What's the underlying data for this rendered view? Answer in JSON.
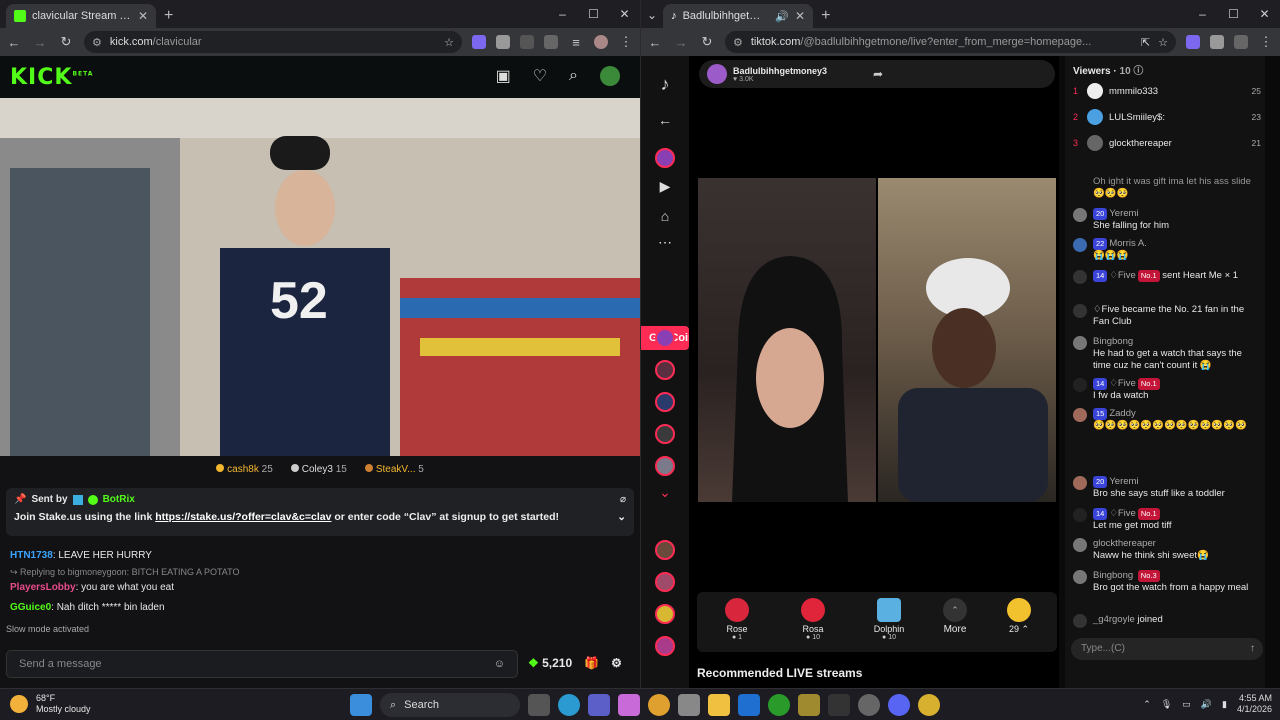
{
  "left_browser": {
    "tab_title": "clavicular Stream - Watch Live o",
    "url_domain": "kick.com",
    "url_path": "/clavicular",
    "logo_text": "KICK",
    "logo_sup": "BETA",
    "top_viewers": [
      {
        "name": "cash8k",
        "count": "25"
      },
      {
        "name": "Coley3",
        "count": "15"
      },
      {
        "name": "SteakV...",
        "count": "5"
      }
    ],
    "pinned": {
      "sent_by_label": "Sent by",
      "sender": "BotRix",
      "message_pre": "Join Stake.us using the link ",
      "link": "https://stake.us/?offer=clav&c=clav",
      "message_post": " or enter code “Clav” at signup to get started!"
    },
    "chat": [
      {
        "user": "HTN1738",
        "text": ": LEAVE HER HURRY"
      },
      {
        "reply": "Replying to bigmoneygoon: BITCH EATING A POTATO"
      },
      {
        "user": "PlayersLobby",
        "text": ": you are what you eat"
      },
      {
        "user": "GGuice0",
        "text": ": Nah ditch ***** bin laden"
      }
    ],
    "slow_mode": "Slow mode activated",
    "send_placeholder": "Send a message",
    "points": "5,210"
  },
  "right_browser": {
    "tab_title": "Badlulbihhgetmoney3 (@b...",
    "url_domain": "tiktok.com",
    "url_path": "/@badlulbihhgetmone/live?enter_from_merge=homepage...",
    "streamer_name": "Badlulbihhgetmoney3",
    "streamer_likes": "3.0K",
    "get_coins": "Get Coins",
    "gifts": [
      {
        "name": "Rose",
        "cost": "1"
      },
      {
        "name": "Rosa",
        "cost": "10"
      },
      {
        "name": "Dolphin",
        "cost": "10"
      }
    ],
    "more_label": "More",
    "coin_count": "29",
    "recommended": "Recommended LIVE streams",
    "viewers_label": "Viewers",
    "viewers_count": "10",
    "top_viewers": [
      {
        "rank": "1",
        "name": "mmmilo333",
        "score": "25"
      },
      {
        "rank": "2",
        "name": "LULSmiiley$:",
        "score": "23"
      },
      {
        "rank": "3",
        "name": "glockthereaper",
        "score": "21"
      }
    ],
    "messages": [
      {
        "name": "",
        "badge": "",
        "text": "Oh ight it was gift ima let his ass slide🥺🥺🥺"
      },
      {
        "name": "Yeremi",
        "badge": "20",
        "text": "She falling for him"
      },
      {
        "name": "Morris A.",
        "badge": "22",
        "text": "😭😭😭"
      },
      {
        "name": "♢Five",
        "badge": "14",
        "text": "sent Heart Me × 1"
      },
      {
        "name": "",
        "badge": "",
        "text": "♢Five became the No. 21 fan in the Fan Club"
      },
      {
        "name": "Bingbong",
        "badge": "",
        "text": "He had to get a watch that says the time cuz he can't count it 😭"
      },
      {
        "name": "♢Five",
        "badge": "14",
        "text": "I fw da watch"
      },
      {
        "name": "Zaddy",
        "badge": "15",
        "text": "🥺🥺🥺🥺🥺🥺🥺🥺🥺🥺🥺🥺🥺"
      },
      {
        "name": "Yeremi",
        "badge": "20",
        "text": "Bro she says stuff like a toddler"
      },
      {
        "name": "♢Five",
        "badge": "14",
        "text": "Let me get mod tiff"
      },
      {
        "name": "glockthereaper",
        "badge": "",
        "text": "Naww he think shi sweet😭"
      },
      {
        "name": "Bingbong",
        "badge": "",
        "text": "Bro got the watch from a happy meal"
      },
      {
        "name": "_g4rgoyle",
        "badge": "",
        "text": "joined"
      }
    ],
    "input_placeholder": "Type...(C)"
  },
  "taskbar": {
    "temp": "68°F",
    "weather": "Mostly cloudy",
    "search": "Search",
    "time": "4:55 AM",
    "date": "4/1/2026"
  },
  "colors": {
    "kick_green": "#53fc18",
    "tiktok_red": "#fe2c55"
  }
}
